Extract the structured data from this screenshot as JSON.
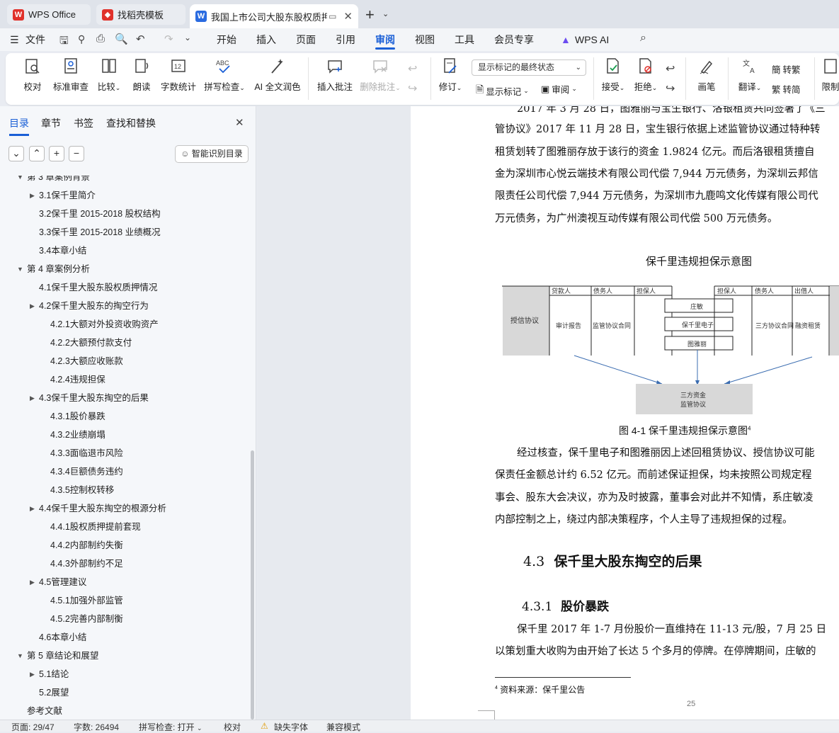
{
  "tabs": [
    {
      "label": "WPS Office",
      "icon": "wps-logo-icon"
    },
    {
      "label": "找稻壳模板",
      "icon": "docer-icon"
    },
    {
      "label": "我国上市公司大股东股权质押",
      "icon": "word-doc-icon"
    }
  ],
  "menu": {
    "file": "文件",
    "items": [
      "开始",
      "插入",
      "页面",
      "引用",
      "审阅",
      "视图",
      "工具",
      "会员专享"
    ],
    "active": "审阅",
    "ai": "WPS AI"
  },
  "ribbon": {
    "proof": "校对",
    "std_review": "标准审查",
    "compare": "比较",
    "read_aloud": "朗读",
    "word_count": "字数统计",
    "spell_check": "拼写检查",
    "ai_polish": "AI 全文润色",
    "insert_comment": "插入批注",
    "delete_comment": "删除批注",
    "revise": "修订",
    "markup_state": "显示标记的最终状态",
    "show_markup": "显示标记",
    "review": "审阅",
    "accept": "接受",
    "reject": "拒绝",
    "brush": "画笔",
    "translate": "翻译",
    "to_simplified": "转繁",
    "to_traditional": "转简",
    "restrict": "限制"
  },
  "panel": {
    "tabs": [
      "目录",
      "章节",
      "书签",
      "查找和替换"
    ],
    "smart_btn": "智能识别目录",
    "toc": [
      {
        "text": "第 3 章案例背景",
        "level": 1,
        "arrow": "down"
      },
      {
        "text": "3.1保千里简介",
        "level": 2,
        "arrow": "right"
      },
      {
        "text": "3.2保千里 2015-2018 股权结构",
        "level": 2,
        "arrow": ""
      },
      {
        "text": "3.3保千里 2015-2018 业绩概况",
        "level": 2,
        "arrow": ""
      },
      {
        "text": "3.4本章小结",
        "level": 2,
        "arrow": ""
      },
      {
        "text": "第 4 章案例分析",
        "level": 1,
        "arrow": "down"
      },
      {
        "text": "4.1保千里大股东股权质押情况",
        "level": 2,
        "arrow": ""
      },
      {
        "text": "4.2保千里大股东的掏空行为",
        "level": 2,
        "arrow": "right"
      },
      {
        "text": "4.2.1大额对外投资收购资产",
        "level": 3,
        "arrow": ""
      },
      {
        "text": "4.2.2大额预付款支付",
        "level": 3,
        "arrow": ""
      },
      {
        "text": "4.2.3大额应收账款",
        "level": 3,
        "arrow": ""
      },
      {
        "text": "4.2.4违规担保",
        "level": 3,
        "arrow": ""
      },
      {
        "text": "4.3保千里大股东掏空的后果",
        "level": 2,
        "arrow": "right"
      },
      {
        "text": "4.3.1股价暴跌",
        "level": 3,
        "arrow": ""
      },
      {
        "text": "4.3.2业绩崩塌",
        "level": 3,
        "arrow": ""
      },
      {
        "text": "4.3.3面临退市风险",
        "level": 3,
        "arrow": ""
      },
      {
        "text": "4.3.4巨额债务违约",
        "level": 3,
        "arrow": ""
      },
      {
        "text": "4.3.5控制权转移",
        "level": 3,
        "arrow": ""
      },
      {
        "text": "4.4保千里大股东掏空的根源分析",
        "level": 2,
        "arrow": "right"
      },
      {
        "text": "4.4.1股权质押提前套现",
        "level": 3,
        "arrow": ""
      },
      {
        "text": "4.4.2内部制约失衡",
        "level": 3,
        "arrow": ""
      },
      {
        "text": "4.4.3外部制约不足",
        "level": 3,
        "arrow": ""
      },
      {
        "text": "4.5管理建议",
        "level": 2,
        "arrow": "right"
      },
      {
        "text": "4.5.1加强外部监管",
        "level": 3,
        "arrow": ""
      },
      {
        "text": "4.5.2完善内部制衡",
        "level": 3,
        "arrow": ""
      },
      {
        "text": "4.6本章小结",
        "level": 2,
        "arrow": ""
      },
      {
        "text": "第 5 章结论和展望",
        "level": 1,
        "arrow": "down"
      },
      {
        "text": "5.1结论",
        "level": 2,
        "arrow": "right"
      },
      {
        "text": "5.2展望",
        "level": 2,
        "arrow": ""
      },
      {
        "text": "参考文献",
        "level": 1,
        "arrow": ""
      }
    ]
  },
  "doc": {
    "lines_top": [
      "2017 年 3 月 28 日，图雅丽与宝生银行、洛银租赁共同签署了《三",
      "管协议》2017 年 11 月 28 日，宝生银行依据上述监管协议通过特种转",
      "租赁划转了图雅丽存放于该行的资金 1.9824 亿元。而后洛银租赁擅自",
      "金为深圳市心悦云端技术有限公司代偿 7,944 万元债务，为深圳云邦信",
      "限责任公司代偿 7,944 万元债务，为深圳市九鹿鸣文化传媒有限公司代",
      "万元债务，为广州澳视互动传媒有限公司代偿 500 万元债务。"
    ],
    "figure_title": "保千里违规担保示意图",
    "diagram": {
      "left_box": "授信协议",
      "left_heads": [
        "贷款人",
        "债务人",
        "担保人"
      ],
      "left_cells": [
        "审计报告",
        "监管协议合同"
      ],
      "center": [
        "庄敏",
        "保千里电子",
        "图雅丽"
      ],
      "right_heads": [
        "担保人",
        "债务人",
        "出借人"
      ],
      "right_cells": [
        "三方协议合同",
        "融资租赁"
      ],
      "bottom": [
        "三方资金",
        "监管协议"
      ]
    },
    "caption": "图 4-1 保千里违规担保示意图",
    "caption_note": "4",
    "lines_mid": [
      "经过核查，保千里电子和图雅丽因上述回租赁协议、授信协议可能",
      "保责任金额总计约 6.52 亿元。而前述保证担保，均未按照公司规定程",
      "事会、股东大会决议，亦为及时披露，董事会对此并不知情，系庄敏凌",
      "内部控制之上，绕过内部决策程序，个人主导了违规担保的过程。"
    ],
    "h2_num": "4.3",
    "h2": "保千里大股东掏空的后果",
    "h3_num": "4.3.1",
    "h3": "股价暴跌",
    "lines_bottom": [
      "保千里 2017 年 1-7 月份股价一直维持在 11-13 元/股，7 月 25 日",
      "以策划重大收购为由开始了长达 5 个多月的停牌。在停牌期间，庄敏的"
    ],
    "footnote": "资料来源：保千里公告",
    "footnote_mark": "4",
    "page_no": "25"
  },
  "status": {
    "page": "页面: 29/47",
    "words": "字数: 26494",
    "spell": "拼写检查: 打开",
    "proof": "校对",
    "missing_font": "缺失字体",
    "compat": "兼容模式"
  },
  "colors": {
    "accent": "#1a5fd6",
    "wps_red": "#e0312b"
  }
}
